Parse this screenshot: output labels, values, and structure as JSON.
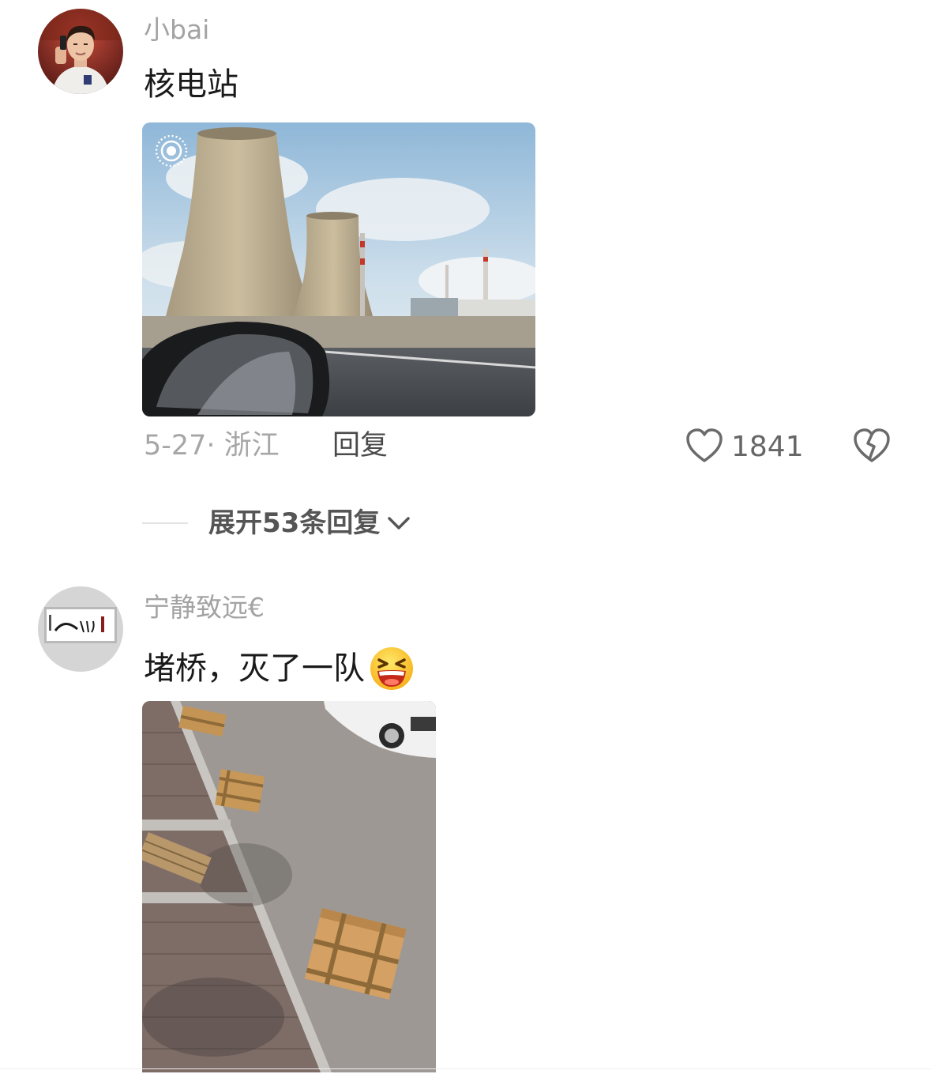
{
  "comments": [
    {
      "username": "小bai",
      "text": "核电站",
      "date_location": "5-27· 浙江",
      "reply_label": "回复",
      "likes": "1841",
      "avatar_icon": "user-avatar-photo",
      "photo_description_icon": "live-photo-icon"
    },
    {
      "username": "宁静致远€",
      "text": "堵桥，灭了一队",
      "emoji_icon": "laughing-emoji-icon"
    }
  ],
  "expand_replies": {
    "label": "展开53条回复"
  },
  "colors": {
    "username": "#a3a3a3",
    "text": "#1a1a1a",
    "meta": "#a6a6a6",
    "reply": "#4a4a4a",
    "expand": "#555555"
  }
}
